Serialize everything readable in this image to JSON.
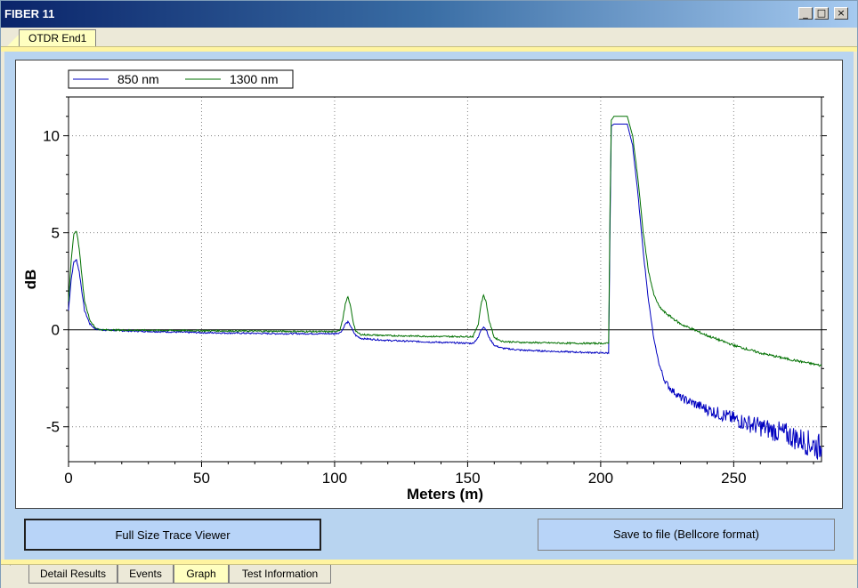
{
  "window": {
    "title": "FIBER 11",
    "minimize_label": "_",
    "maximize_label": "□",
    "close_label": "×"
  },
  "top_tabs": [
    {
      "label": "OTDR End1",
      "active": true
    }
  ],
  "bottom_tabs": [
    {
      "label": "Detail Results",
      "active": false
    },
    {
      "label": "Events",
      "active": false
    },
    {
      "label": "Graph",
      "active": true
    },
    {
      "label": "Test Information",
      "active": false
    }
  ],
  "buttons": {
    "full_size_label": "Full Size Trace Viewer",
    "save_label": "Save to file (Bellcore format)"
  },
  "colors": {
    "series_850": "#0000c0",
    "series_1300": "#007000",
    "panel_background": "#b8d4f0",
    "tab_active": "#ffffc0"
  },
  "chart_data": {
    "type": "line",
    "xlabel": "Meters (m)",
    "ylabel": "dB",
    "xlim": [
      0,
      283
    ],
    "ylim": [
      -6.8,
      12
    ],
    "xticks": [
      0,
      50,
      100,
      150,
      200,
      250
    ],
    "yticks": [
      -5,
      0,
      5,
      10
    ],
    "grid": true,
    "legend_position": "top-left",
    "series": [
      {
        "name": "850 nm",
        "color": "#0000c0",
        "x": [
          0,
          1,
          2,
          3,
          4,
          5,
          6,
          8,
          10,
          12,
          20,
          50,
          80,
          100,
          102,
          103,
          104,
          105,
          106,
          107,
          108,
          110,
          120,
          140,
          152,
          154,
          155,
          156,
          157,
          158,
          160,
          163,
          170,
          190,
          203,
          203.5,
          204,
          205,
          210,
          212,
          214,
          216,
          218,
          220,
          222,
          224,
          226,
          230,
          240,
          250,
          260,
          270,
          283
        ],
        "y": [
          1.0,
          2.6,
          3.5,
          3.6,
          3.0,
          2.0,
          1.0,
          0.3,
          0.05,
          0.0,
          -0.05,
          -0.15,
          -0.2,
          -0.2,
          -0.15,
          -0.0,
          0.3,
          0.4,
          0.2,
          -0.1,
          -0.3,
          -0.45,
          -0.55,
          -0.65,
          -0.7,
          -0.4,
          0.0,
          0.15,
          0.0,
          -0.4,
          -0.8,
          -0.95,
          -1.05,
          -1.15,
          -1.2,
          5.0,
          10.5,
          10.6,
          10.6,
          9.5,
          7.0,
          4.0,
          1.5,
          -0.5,
          -1.8,
          -2.6,
          -3.0,
          -3.5,
          -4.1,
          -4.6,
          -5.0,
          -5.4,
          -6.1
        ]
      },
      {
        "name": "1300 nm",
        "color": "#007000",
        "x": [
          0,
          1,
          2,
          3,
          4,
          5,
          6,
          8,
          10,
          12,
          20,
          50,
          80,
          100,
          102,
          103,
          104,
          105,
          106,
          107,
          108,
          110,
          120,
          140,
          152,
          154,
          155,
          156,
          157,
          158,
          160,
          163,
          170,
          190,
          203,
          203.5,
          204,
          205,
          210,
          212,
          214,
          216,
          218,
          220,
          222,
          224,
          226,
          230,
          240,
          250,
          260,
          270,
          283
        ],
        "y": [
          1.5,
          3.6,
          4.9,
          5.1,
          4.2,
          2.8,
          1.5,
          0.5,
          0.1,
          0.0,
          -0.02,
          -0.05,
          -0.08,
          -0.1,
          0.0,
          0.5,
          1.3,
          1.7,
          1.2,
          0.4,
          -0.1,
          -0.25,
          -0.3,
          -0.35,
          -0.35,
          0.3,
          1.3,
          1.8,
          1.4,
          0.5,
          -0.4,
          -0.6,
          -0.65,
          -0.7,
          -0.7,
          6.0,
          10.8,
          11.0,
          11.0,
          10.0,
          7.8,
          5.0,
          3.0,
          1.8,
          1.2,
          0.9,
          0.7,
          0.3,
          -0.3,
          -0.8,
          -1.2,
          -1.5,
          -1.85
        ]
      }
    ]
  }
}
